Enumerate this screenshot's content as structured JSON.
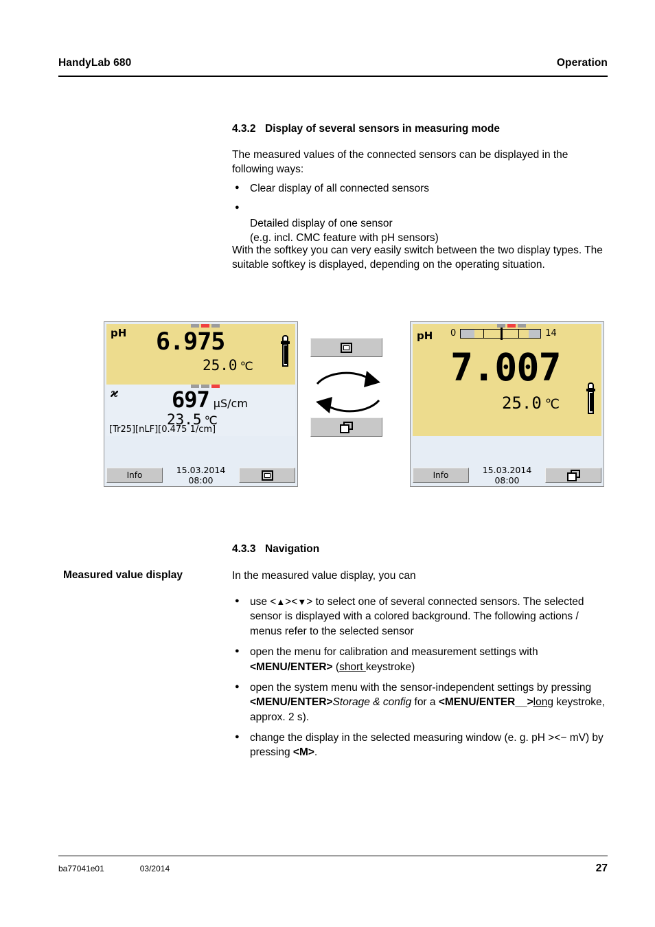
{
  "header": {
    "title": "HandyLab 680",
    "chapter": "Operation"
  },
  "footer": {
    "doc_id": "ba77041e01",
    "date": "03/2014",
    "page": "27"
  },
  "sections": {
    "s432": {
      "number": "4.3.2",
      "title": "Display of several sensors in measuring mode",
      "intro": "The measured values of the connected sensors can be displayed in the following ways:",
      "bullets": [
        "Clear display of all connected sensors",
        "Detailed display of one sensor\n(e.g. incl. CMC feature with pH sensors)"
      ],
      "outro": "With the softkey you can very easily switch between the two display types. The suitable softkey is displayed, depending on the operating situation."
    },
    "s433": {
      "number": "4.3.3",
      "title": "Navigation",
      "margin_label": "Measured value display",
      "lead": "In the measured value display, you can",
      "b1_a": "use <",
      "b1_up": "▲",
      "b1_b": "><",
      "b1_dn": "▼",
      "b1_c": "> to select one of several connected sensors. The selected sensor is displayed with a colored background. The following actions / menus refer to the selected sensor",
      "b2_a": "open the menu for calibration and measurement settings with ",
      "b2_key": "<MENU/ENTER>",
      "b2_b": " (",
      "b2_u": "short ",
      "b2_c": "keystroke)",
      "b3_a": "open the system menu with the sensor-independent settings by pressing ",
      "b3_key1": "<MENU/ENTER>",
      "b3_it": "Storage & config",
      "b3_b": " for a ",
      "b3_key2": "<MENU/",
      "b3_key3": "ENTER__>",
      "b3_u": "long",
      "b3_c": " keystroke, approx. 2 s).",
      "b4_a": "change the display in the selected measuring window (e. g. pH ",
      "b4_sym": "><−",
      "b4_b": " mV) by pressing ",
      "b4_key": "<M>",
      "b4_c": "."
    }
  },
  "display_left": {
    "name": "clear-display-all-sensors",
    "window1": {
      "sensor": "pH",
      "value": "6.975",
      "temperature": "25.0",
      "temp_unit": "℃",
      "segments": [
        "gray",
        "red",
        "gray"
      ],
      "selected": true,
      "probe_icon": "ph-electrode-icon"
    },
    "window2": {
      "sensor": "ϰ",
      "value": "697",
      "unit": "µS/cm",
      "temperature": "23.5",
      "temp_unit": "℃",
      "info_line": "[Tr25][nLF][0.475 1/cm]",
      "segments": [
        "gray",
        "gray",
        "red"
      ],
      "selected": false
    },
    "bar": {
      "info_label": "Info",
      "timestamp": "15.03.2014 08:00",
      "softkey_icon": "single-window-icon"
    }
  },
  "display_right": {
    "name": "detailed-display-one-sensor",
    "window": {
      "sensor": "pH",
      "value": "7.007",
      "temperature": "25.0",
      "temp_unit": "℃",
      "segments": [
        "gray",
        "red",
        "gray"
      ],
      "selected": true,
      "probe_icon": "ph-electrode-icon",
      "cmc": {
        "min_label": "0",
        "max_label": "14",
        "pointer_value": 7.007,
        "range": [
          0,
          14
        ],
        "valid_zone": [
          2.0,
          12.0
        ],
        "ticks": [
          4.0,
          10.0
        ]
      }
    },
    "bar": {
      "info_label": "Info",
      "timestamp": "15.03.2014 08:00",
      "softkey_icon": "multi-window-icon"
    }
  },
  "swap_control": {
    "top_icon": "single-window-icon",
    "bottom_icon": "multi-window-icon",
    "arrows": "circular-swap-arrows-icon"
  },
  "colors": {
    "selected_bg": "#eddc8e",
    "unselected_bg": "#e9eff6",
    "marker_active": "#f04040",
    "marker_inactive": "#9c9c9c",
    "softkey_face": "#c8c8c8"
  }
}
